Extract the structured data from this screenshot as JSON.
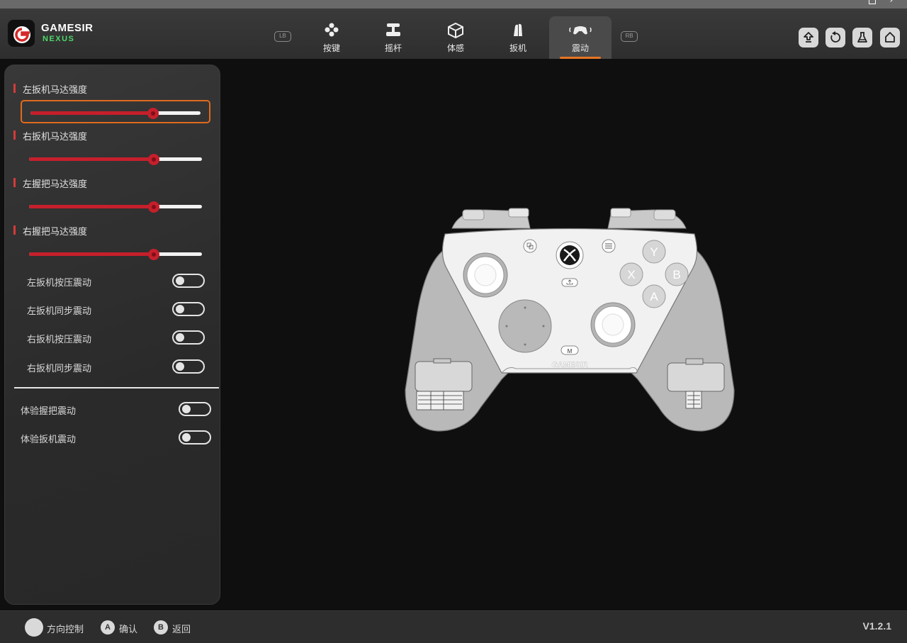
{
  "app": {
    "brand": "GAMESIR",
    "brand_sub": "NEXUS",
    "version": "V1.2.1"
  },
  "nav": {
    "lb": "LB",
    "rb": "RB",
    "tabs": [
      {
        "label": "按键",
        "icon": "buttons-icon",
        "active": false
      },
      {
        "label": "摇杆",
        "icon": "joystick-icon",
        "active": false
      },
      {
        "label": "体感",
        "icon": "motion-icon",
        "active": false
      },
      {
        "label": "扳机",
        "icon": "trigger-icon",
        "active": false
      },
      {
        "label": "震动",
        "icon": "vibration-icon",
        "active": true
      }
    ],
    "tools": [
      "upload-icon",
      "reset-icon",
      "flask-icon",
      "home-icon"
    ]
  },
  "vibration": {
    "sliders": [
      {
        "label": "左扳机马达强度",
        "value": 0.72,
        "focused": true
      },
      {
        "label": "右扳机马达强度",
        "value": 0.72,
        "focused": false
      },
      {
        "label": "左握把马达强度",
        "value": 0.72,
        "focused": false
      },
      {
        "label": "右握把马达强度",
        "value": 0.72,
        "focused": false
      }
    ],
    "toggles": [
      {
        "label": "左扳机按压震动",
        "on": false
      },
      {
        "label": "左扳机同步震动",
        "on": false
      },
      {
        "label": "右扳机按压震动",
        "on": false
      },
      {
        "label": "右扳机同步震动",
        "on": false
      }
    ],
    "test_toggles": [
      {
        "label": "体验握把震动",
        "on": false
      },
      {
        "label": "体验扳机震动",
        "on": false
      }
    ]
  },
  "controller": {
    "face_buttons": [
      "Y",
      "X",
      "B",
      "A"
    ],
    "m_button": "M",
    "brand": "GAMESIR"
  },
  "footer": {
    "hints": [
      {
        "key": "",
        "label": "方向控制"
      },
      {
        "key": "A",
        "label": "确认"
      },
      {
        "key": "B",
        "label": "返回"
      }
    ]
  }
}
